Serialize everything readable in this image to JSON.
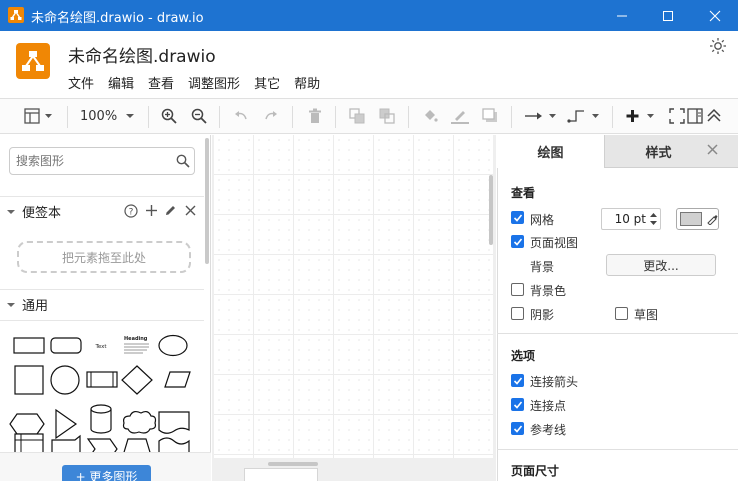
{
  "window": {
    "title": "未命名绘图.drawio - draw.io",
    "minimize": "—",
    "maximize": "☐",
    "close": "✕"
  },
  "app": {
    "doc_title": "未命名绘图.drawio",
    "theme_icon": "sun-icon"
  },
  "menu": [
    "文件",
    "编辑",
    "查看",
    "调整图形",
    "其它",
    "帮助"
  ],
  "toolbar": {
    "zoom": "100%"
  },
  "sidebar": {
    "search_placeholder": "搜索图形",
    "scratchpad_title": "便签本",
    "scratchpad_drop": "把元素拖至此处",
    "general_title": "通用",
    "more_shapes": "+ 更多图形",
    "shape_text": "Text",
    "shape_heading": "Heading"
  },
  "panel": {
    "tabs": [
      "绘图",
      "样式"
    ],
    "view_heading": "查看",
    "grid_label": "网格",
    "grid_size": "10 pt",
    "page_view_label": "页面视图",
    "background_label": "背景",
    "change_button": "更改...",
    "bg_color_label": "背景色",
    "shadow_label": "阴影",
    "sketch_label": "草图",
    "options_heading": "选项",
    "connection_arrows": "连接箭头",
    "connection_points": "连接点",
    "guides": "参考线",
    "page_size_heading": "页面尺寸"
  },
  "colors": {
    "titlebar": "#1e73d1",
    "brand": "#f08705",
    "accent": "#1a73e8"
  }
}
